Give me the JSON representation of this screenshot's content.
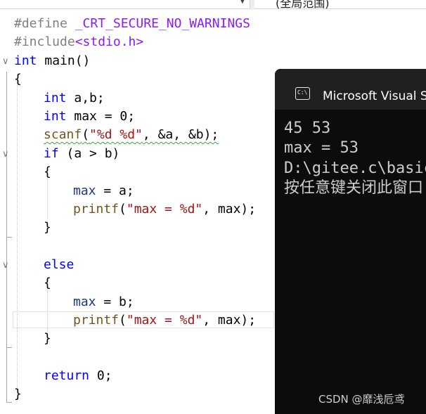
{
  "toolbar": {
    "scope_label": "(全局范围)"
  },
  "code": {
    "l1a": "#define ",
    "l1b": "_CRT_SECURE_NO_WARNINGS",
    "l2a": "#include",
    "l2b": "<stdio.h>",
    "l3a": "int",
    "l3b": " main()",
    "l4": "{",
    "l5a": "int",
    "l5b": " a,b;",
    "l6a": "int",
    "l6b": " max = 0;",
    "l7a": "scanf",
    "l7b": "(",
    "l7c": "\"%d %d\"",
    "l7d": ", &a, &b);",
    "l8a": "if",
    "l8b": " (a > b)",
    "l9": "{",
    "l10a": "max",
    "l10b": " = a;",
    "l11a": "printf",
    "l11b": "(",
    "l11c": "\"max = %d\"",
    "l11d": ", max);",
    "l12": "}",
    "l14a": "else",
    "l15": "{",
    "l16a": "max",
    "l16b": " = b;",
    "l17a": "printf",
    "l17b": "(",
    "l17c": "\"max = %d\"",
    "l17d": ", max);",
    "l18": "}",
    "l20a": "return",
    "l20b": " 0;",
    "l21": "}"
  },
  "console": {
    "title": "Microsoft Visual Studio 调试控制台",
    "lines": [
      "45 53",
      "max = 53",
      "D:\\gitee.c\\basic",
      "按任意键关闭此窗口"
    ]
  },
  "watermark": "CSDN @靡浅卮鸢",
  "colors": {
    "keyword": "#0000ff",
    "string": "#a31515",
    "function": "#74531f",
    "macro": "#8a1bff",
    "console_bg": "#0c0c0c"
  }
}
